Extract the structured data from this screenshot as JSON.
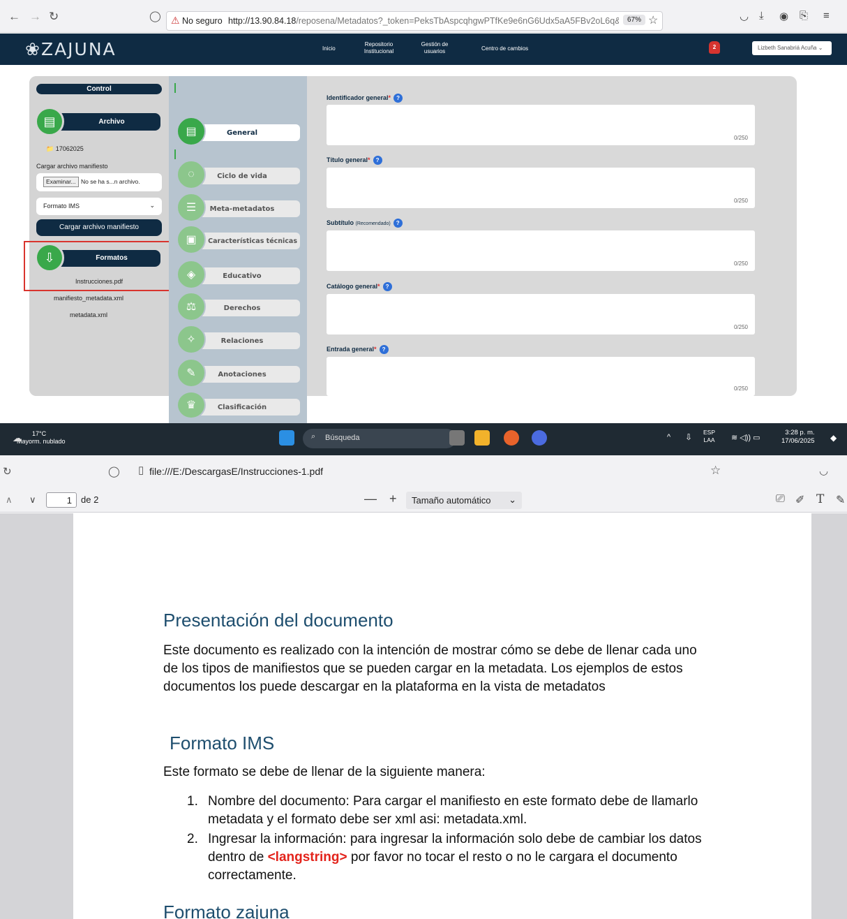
{
  "browser": {
    "security_label": "No seguro",
    "url_host": "http://13.90.84.18",
    "url_path": "/reposena/Metadatos?_token=PeksTbAspcqhgwPTfKe9e6nG6Udx5aA5FBv2oL6q&id=",
    "zoom": "67%"
  },
  "app": {
    "logo": "ZAJUNA",
    "nav": [
      {
        "label": "Inicio"
      },
      {
        "label": "Repositorio Institucional"
      },
      {
        "label": "Gestión de usuarios"
      },
      {
        "label": "Centro de cambios"
      }
    ],
    "notification_count": "2",
    "user_name": "Lizbeth Sanabriá Acuña"
  },
  "control": {
    "title": "Control",
    "archivo_label": "Archivo",
    "folder_name": "17062025",
    "upload_label": "Cargar archivo manifiesto",
    "browse_button": "Examinar...",
    "no_file_text": "No se ha s...n archivo.",
    "format_selected": "Formato IMS",
    "upload_button": "Cargar archivo manifiesto",
    "formatos_label": "Formatos",
    "files": [
      "Instrucciones.pdf",
      "manifiesto_metadata.xml",
      "metadata.xml"
    ]
  },
  "tabs": [
    {
      "label": "General",
      "icon": "document-icon",
      "active": true
    },
    {
      "label": "Ciclo de vida",
      "icon": "cycle-icon"
    },
    {
      "label": "Meta-metadatos",
      "icon": "list-icon"
    },
    {
      "label": "Características técnicas",
      "icon": "clipboard-icon"
    },
    {
      "label": "Educativo",
      "icon": "graduation-icon"
    },
    {
      "label": "Derechos",
      "icon": "scales-icon"
    },
    {
      "label": "Relaciones",
      "icon": "handshake-icon"
    },
    {
      "label": "Anotaciones",
      "icon": "note-icon"
    },
    {
      "label": "Clasificación",
      "icon": "trophy-icon"
    }
  ],
  "form": {
    "fields": [
      {
        "label": "Identificador general",
        "required": "*",
        "counter": "0/250"
      },
      {
        "label": "Título general",
        "required": "*",
        "counter": "0/250"
      },
      {
        "label": "Subtítulo",
        "note": "(Recomendado)",
        "counter": "0/250"
      },
      {
        "label": "Catálogo general",
        "required": "*",
        "counter": "0/250"
      },
      {
        "label": "Entrada general",
        "required": "*",
        "counter": "0/250"
      }
    ]
  },
  "taskbar": {
    "temp": "17°C",
    "weather": "Mayorm. nublado",
    "search_placeholder": "Búsqueda",
    "lang_top": "ESP",
    "lang_bottom": "LAA",
    "time": "3:28 p. m.",
    "date": "17/06/2025"
  },
  "pdf": {
    "url": "file:///E:/DescargasE/Instrucciones-1.pdf",
    "page": "1",
    "page_of": "de 2",
    "zoom_label": "Tamaño automático",
    "heading1": "Presentación del documento",
    "para1": "Este documento es realizado con la intención de mostrar cómo se debe de llenar cada uno de los tipos de manifiestos que se pueden cargar en la metadata. Los ejemplos de estos documentos los puede descargar en la plataforma en la vista de metadatos",
    "heading2": "Formato IMS",
    "para2": "Este formato se debe de llenar de la siguiente manera:",
    "item1": "Nombre del documento: Para cargar el manifiesto en este formato debe de llamarlo metadata y el formato debe ser xml asi: metadata.xml.",
    "item2_pre": "Ingresar la información: para ingresar la información solo debe de cambiar los datos dentro de ",
    "item2_tag": "<langstring>",
    "item2_post": " por favor no tocar el resto o no le cargara el documento correctamente.",
    "heading3": "Formato zajuna"
  },
  "colors": {
    "navy": "#0f2b43",
    "green": "#39a84a",
    "highlight_red": "#d9342e"
  }
}
